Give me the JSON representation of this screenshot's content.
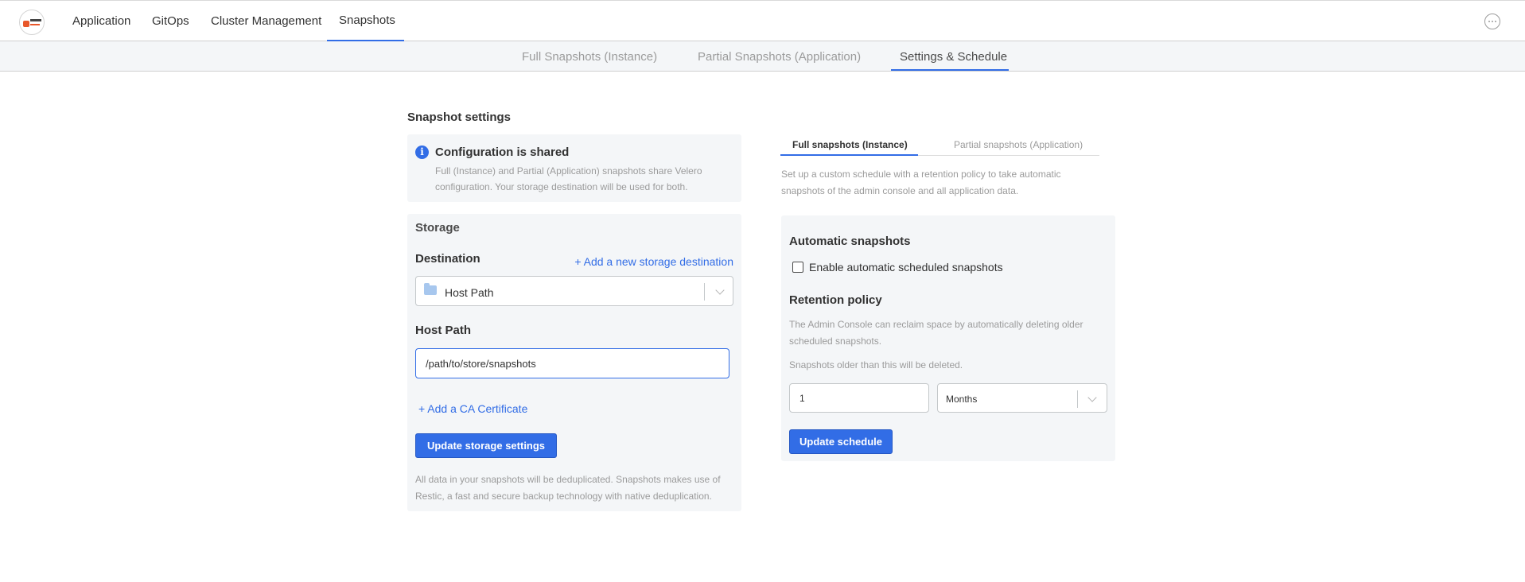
{
  "topnav": {
    "logo_icon": "replicated-logo-icon",
    "items": [
      {
        "label": "Application",
        "active": false
      },
      {
        "label": "GitOps",
        "active": false
      },
      {
        "label": "Cluster Management",
        "active": false
      },
      {
        "label": "Snapshots",
        "active": true
      }
    ],
    "more_icon": "more-options-icon"
  },
  "subnav": {
    "tabs": [
      {
        "label": "Full Snapshots (Instance)",
        "active": false
      },
      {
        "label": "Partial Snapshots (Application)",
        "active": false
      },
      {
        "label": "Settings & Schedule",
        "active": true
      }
    ]
  },
  "settings": {
    "title": "Snapshot settings",
    "info": {
      "icon": "info-icon",
      "title": "Configuration is shared",
      "text": "Full (Instance) and Partial (Application) snapshots share Velero configuration. Your storage destination will be used for both."
    },
    "storage": {
      "title": "Storage",
      "destination_label": "Destination",
      "add_destination_link": "+ Add a new storage destination",
      "destination_value": "Host Path",
      "host_path_label": "Host Path",
      "host_path_value": "/path/to/store/snapshots",
      "add_ca_link": "+ Add a CA Certificate",
      "update_button": "Update storage settings",
      "dedupe_note": "All data in your snapshots will be deduplicated. Snapshots makes use of Restic, a fast and secure backup technology with native deduplication."
    }
  },
  "schedule": {
    "tabs": [
      {
        "label": "Full snapshots (Instance)",
        "active": true
      },
      {
        "label": "Partial snapshots (Application)",
        "active": false
      }
    ],
    "description": "Set up a custom schedule with a retention policy to take automatic snapshots of the admin console and all application data.",
    "auto_title": "Automatic snapshots",
    "enable_label": "Enable automatic scheduled snapshots",
    "enable_checked": false,
    "retention_title": "Retention policy",
    "retention_text": "The Admin Console can reclaim space by automatically deleting older scheduled snapshots.",
    "older_text": "Snapshots older than this will be deleted.",
    "retention_value": "1",
    "retention_unit": "Months",
    "update_button": "Update schedule"
  },
  "colors": {
    "accent": "#326de6",
    "panel_bg": "#f4f6f8",
    "muted_text": "#9b9b9b"
  }
}
